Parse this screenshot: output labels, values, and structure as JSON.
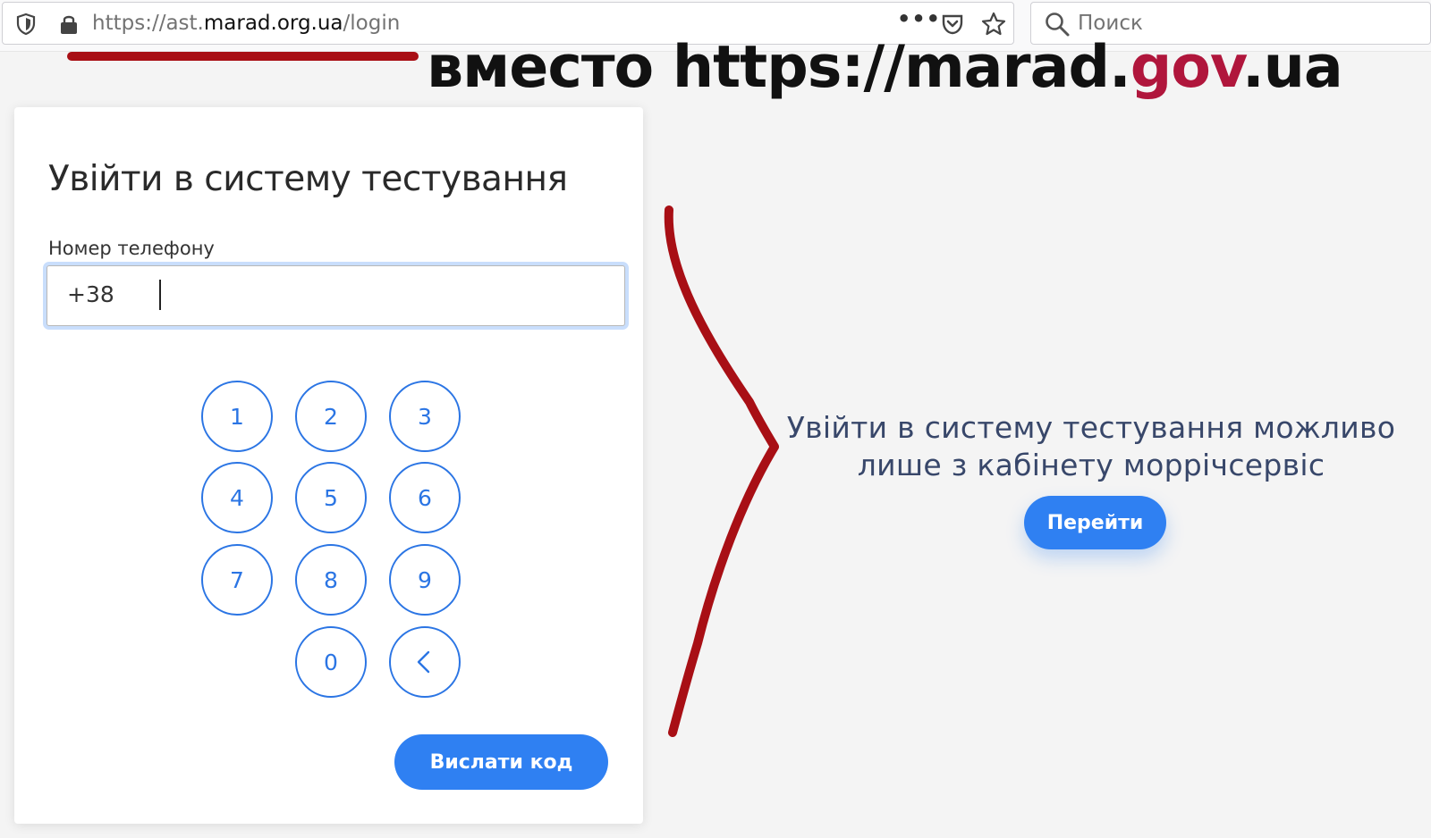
{
  "browser": {
    "url_prefix": "https://ast.",
    "url_domain": "marad.org.ua",
    "url_path": "/login",
    "more_label": "•••",
    "search_placeholder": "Поиск"
  },
  "annotation": {
    "text_before": "вместо https://marad.",
    "text_highlight": "gov",
    "text_after": ".ua",
    "highlight_color": "#b0163c",
    "marker_color": "#a80f15"
  },
  "login": {
    "title": "Увійти в систему тестування",
    "phone_label": "Номер телефону",
    "phone_value": "+38",
    "keys": [
      "1",
      "2",
      "3",
      "4",
      "5",
      "6",
      "7",
      "8",
      "9",
      "0"
    ],
    "backspace_icon": "chevron-left-icon",
    "send_label": "Вислати код"
  },
  "info": {
    "message": "Увійти в систему тестування можливо лише з кабінету моррічсервіс",
    "go_label": "Перейти"
  },
  "colors": {
    "accent": "#2f80f2",
    "key_border": "#2b75e4",
    "text_dark": "#2a2a2a",
    "info_text": "#38476a",
    "background": "#f4f4f4"
  }
}
